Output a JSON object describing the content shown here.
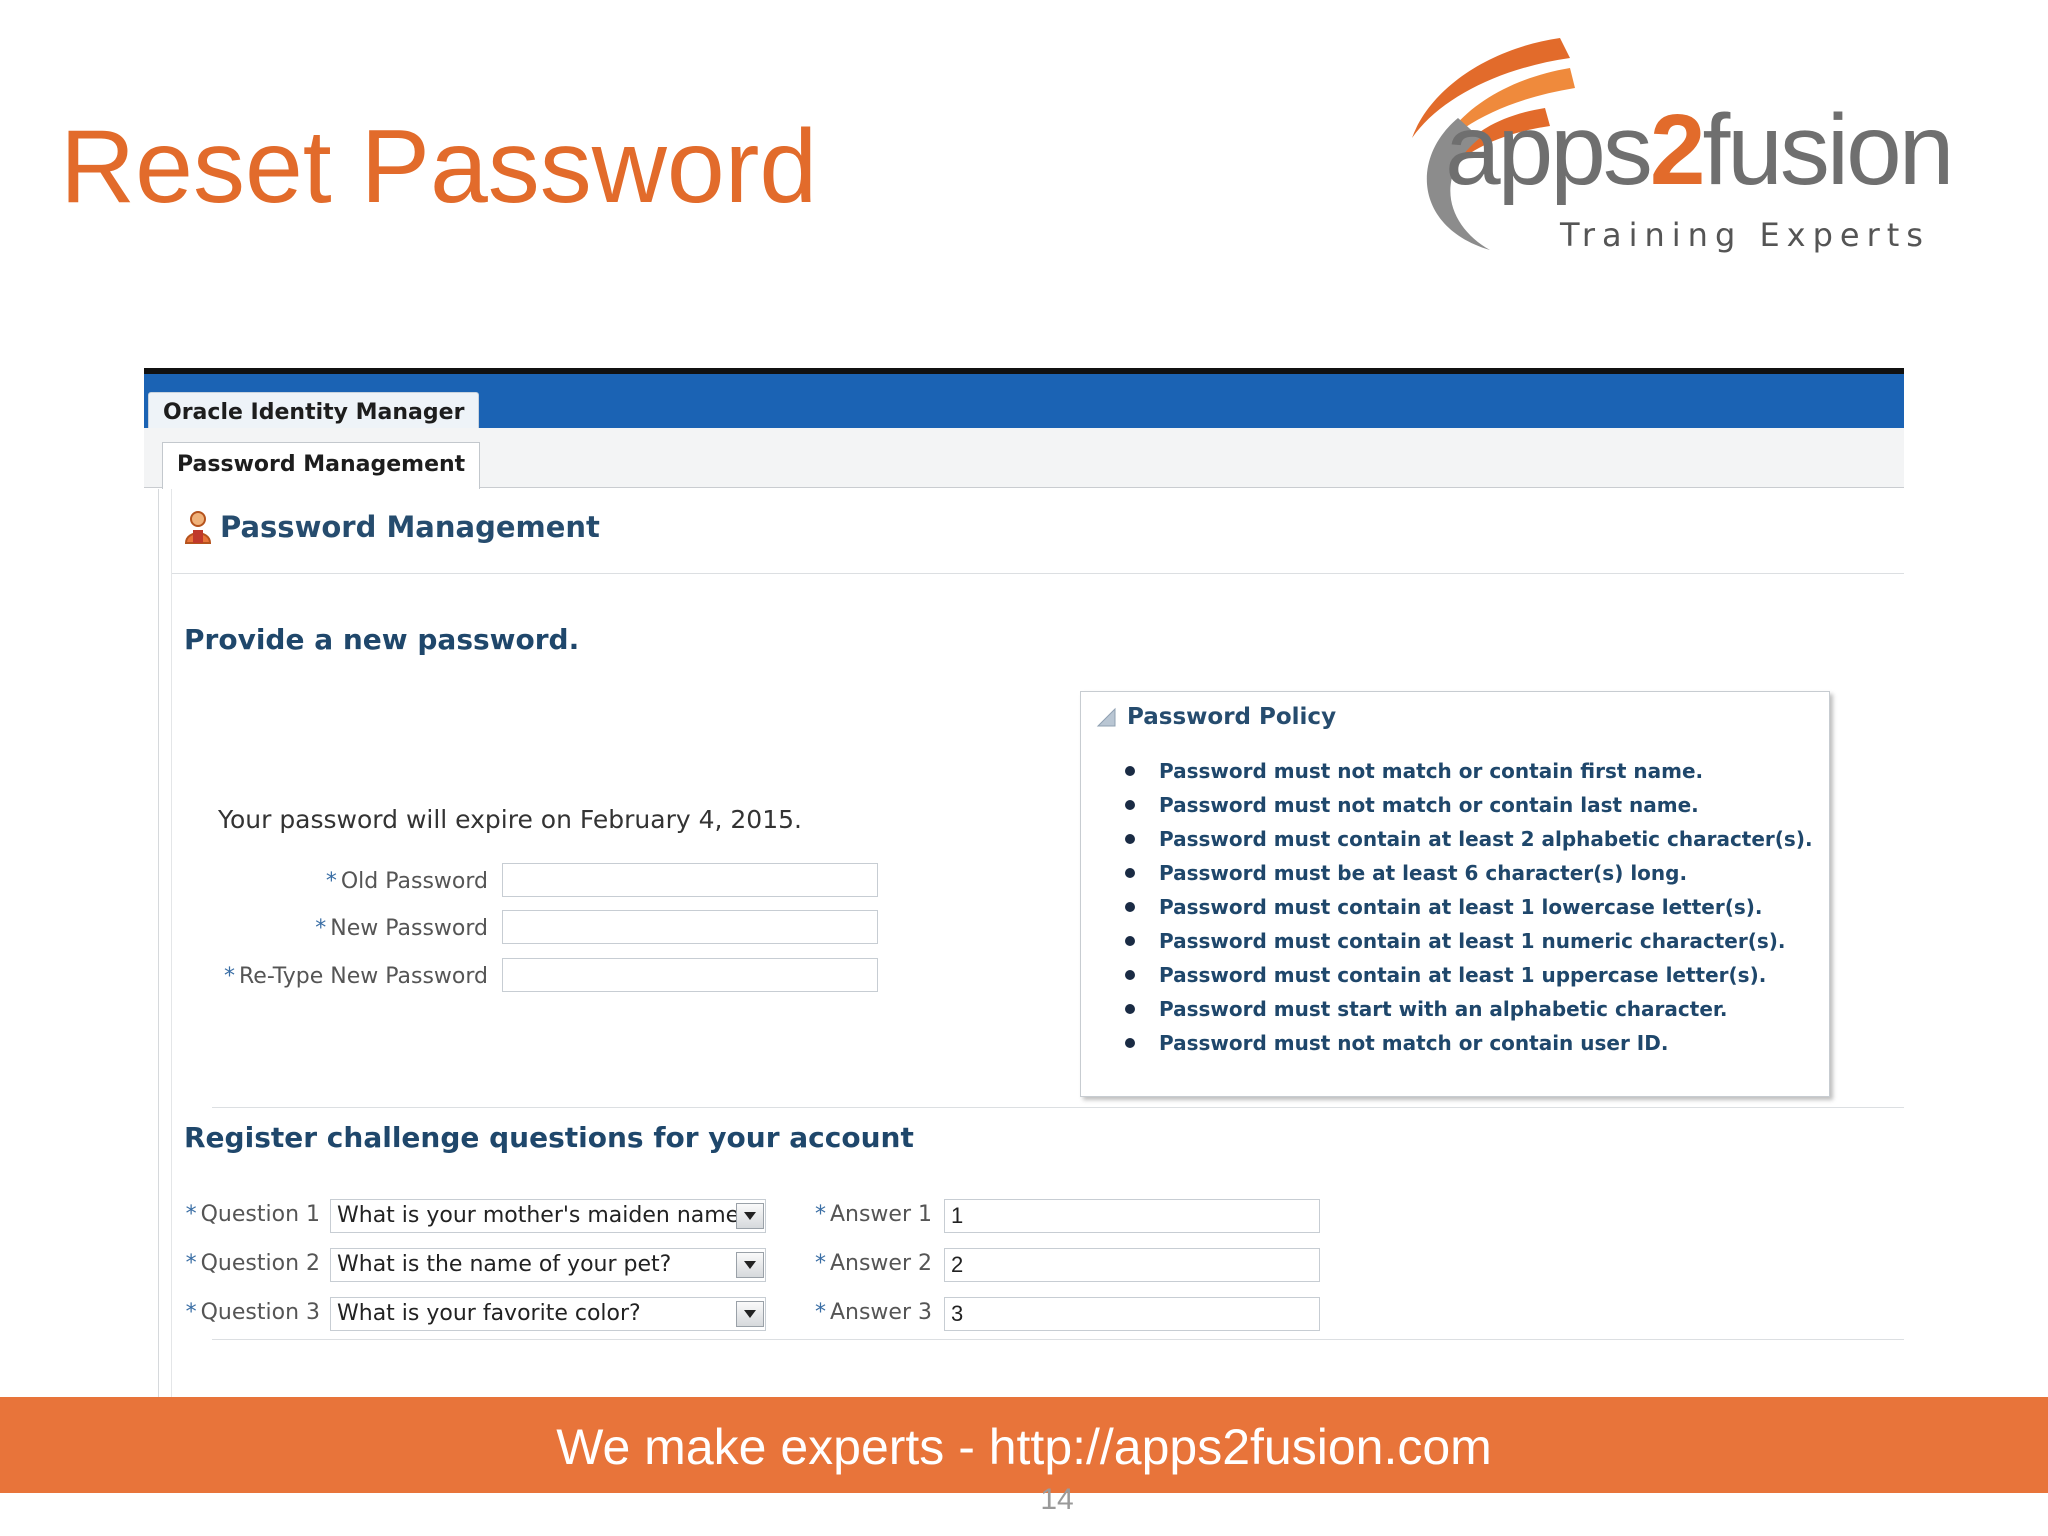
{
  "slide": {
    "title": "Reset Password",
    "logo": {
      "prefix": "apps",
      "two": "2",
      "suffix": "fusion",
      "tagline": "Training Experts"
    },
    "footer": "We make experts - http://apps2fusion.com",
    "page_number": "14",
    "colors": {
      "accent": "#e26b2b",
      "footer": "#e8743a",
      "nav_blue": "#1b63b4"
    }
  },
  "app": {
    "title_tab": "Oracle Identity Manager",
    "sub_tab": "Password Management",
    "header": "Password Management",
    "header_icon": "person-icon"
  },
  "password_section": {
    "heading": "Provide a new password.",
    "expire_text": "Your password will expire on February 4, 2015.",
    "fields": [
      {
        "label": "Old Password",
        "value": ""
      },
      {
        "label": "New Password",
        "value": ""
      },
      {
        "label": "Re-Type New Password",
        "value": ""
      }
    ]
  },
  "policy": {
    "title": "Password Policy",
    "rules": [
      "Password must not match or contain first name.",
      "Password must not match or contain last name.",
      "Password must contain at least 2 alphabetic character(s).",
      "Password must be at least 6 character(s) long.",
      "Password must contain at least 1 lowercase letter(s).",
      "Password must contain at least 1 numeric character(s).",
      "Password must contain at least 1 uppercase letter(s).",
      "Password must start with an alphabetic character.",
      "Password must not match or contain user ID."
    ]
  },
  "challenge": {
    "heading": "Register challenge questions for your account",
    "required_marker": "*",
    "rows": [
      {
        "q_label": "Question 1",
        "question": "What is your mother's maiden name?",
        "a_label": "Answer 1",
        "answer": "1"
      },
      {
        "q_label": "Question 2",
        "question": "What is the name of your pet?",
        "a_label": "Answer 2",
        "answer": "2"
      },
      {
        "q_label": "Question 3",
        "question": "What is your favorite color?",
        "a_label": "Answer 3",
        "answer": "3"
      }
    ]
  }
}
